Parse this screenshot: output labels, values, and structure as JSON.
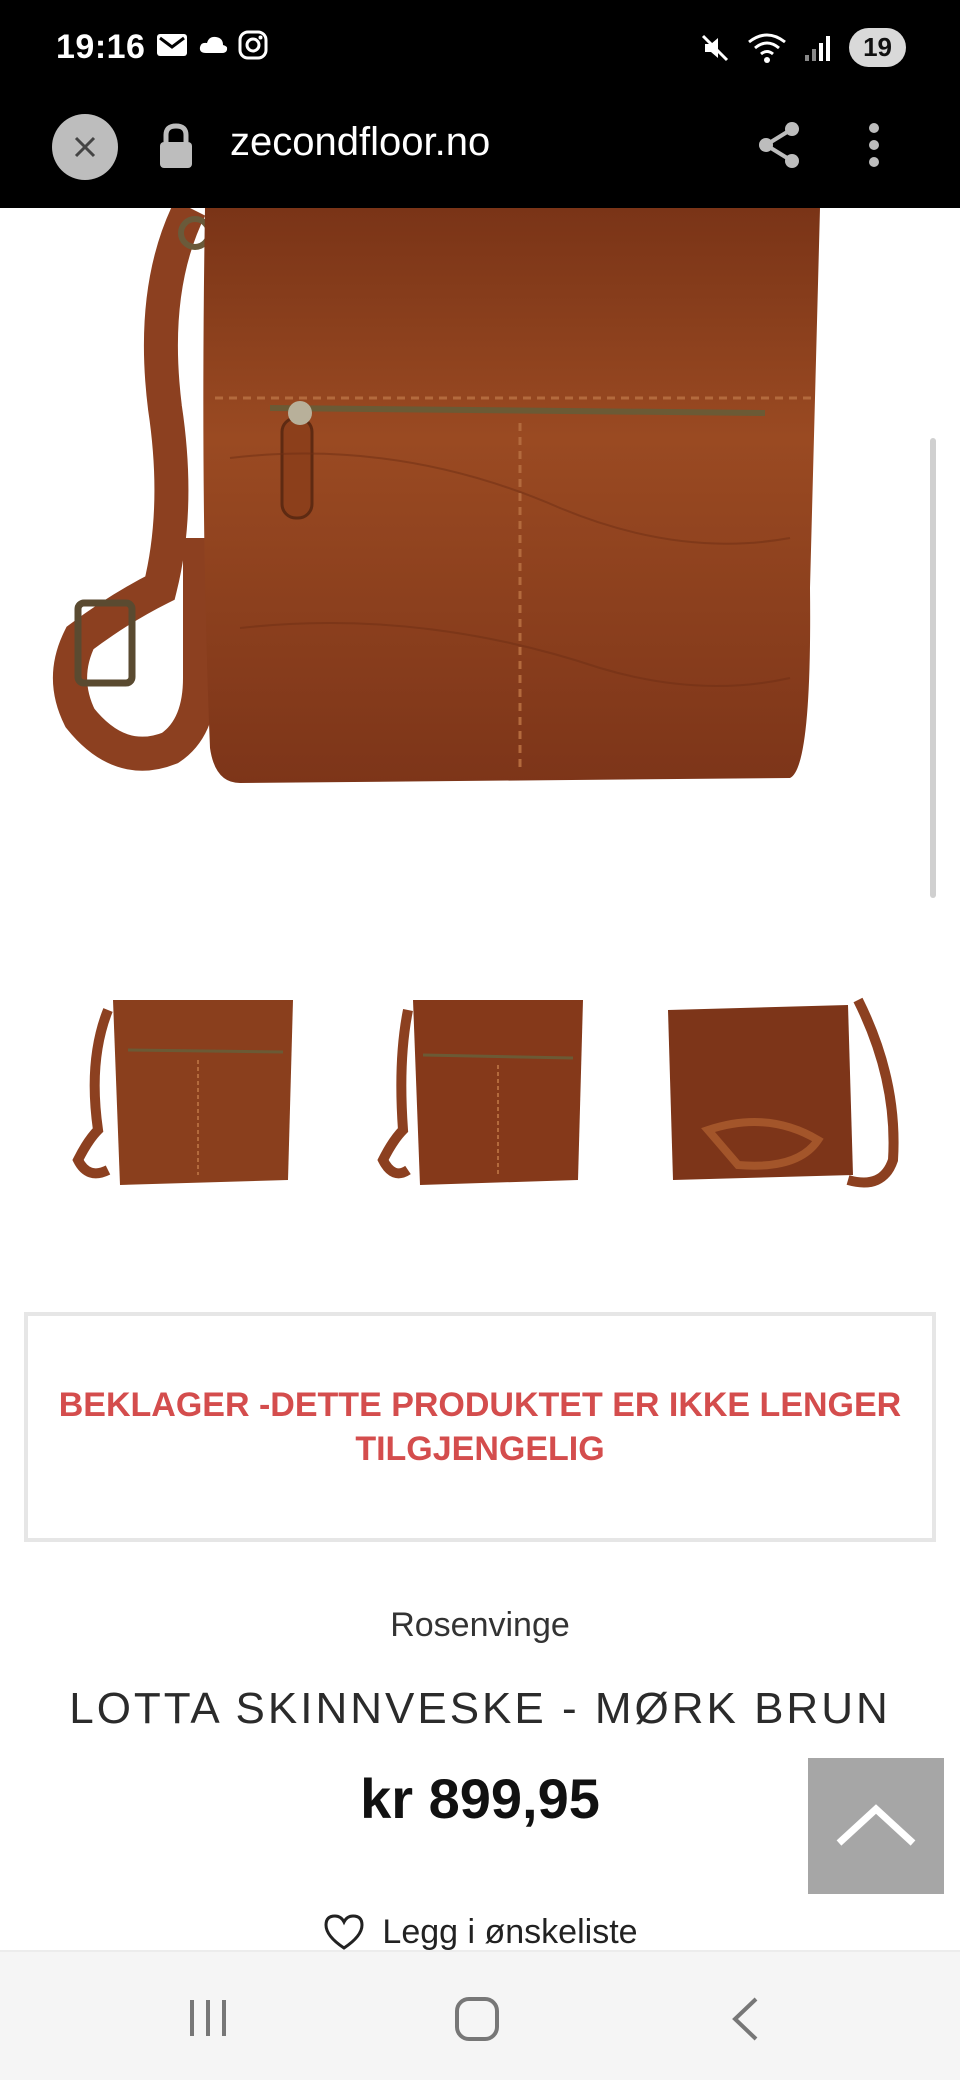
{
  "status_bar": {
    "time": "19:16",
    "battery": "19",
    "icons_left": [
      "mail-icon",
      "cloud-icon",
      "instagram-icon"
    ],
    "icons_right": [
      "mute-icon",
      "wifi-icon",
      "signal-icon"
    ]
  },
  "browser": {
    "url": "zecondfloor.no"
  },
  "thumbnails": [
    "thumbnail-front",
    "thumbnail-side",
    "thumbnail-back"
  ],
  "notice": {
    "text": "BEKLAGER -DETTE PRODUKTET ER IKKE LENGER TILGJENGELIG"
  },
  "product": {
    "brand": "Rosenvinge",
    "title": "LOTTA SKINNVESKE - MØRK BRUN",
    "price": "kr 899,95",
    "wishlist_label": "Legg i ønskeliste"
  },
  "colors": {
    "notice": "#d44d4d",
    "leather": "#8a3f1d"
  }
}
